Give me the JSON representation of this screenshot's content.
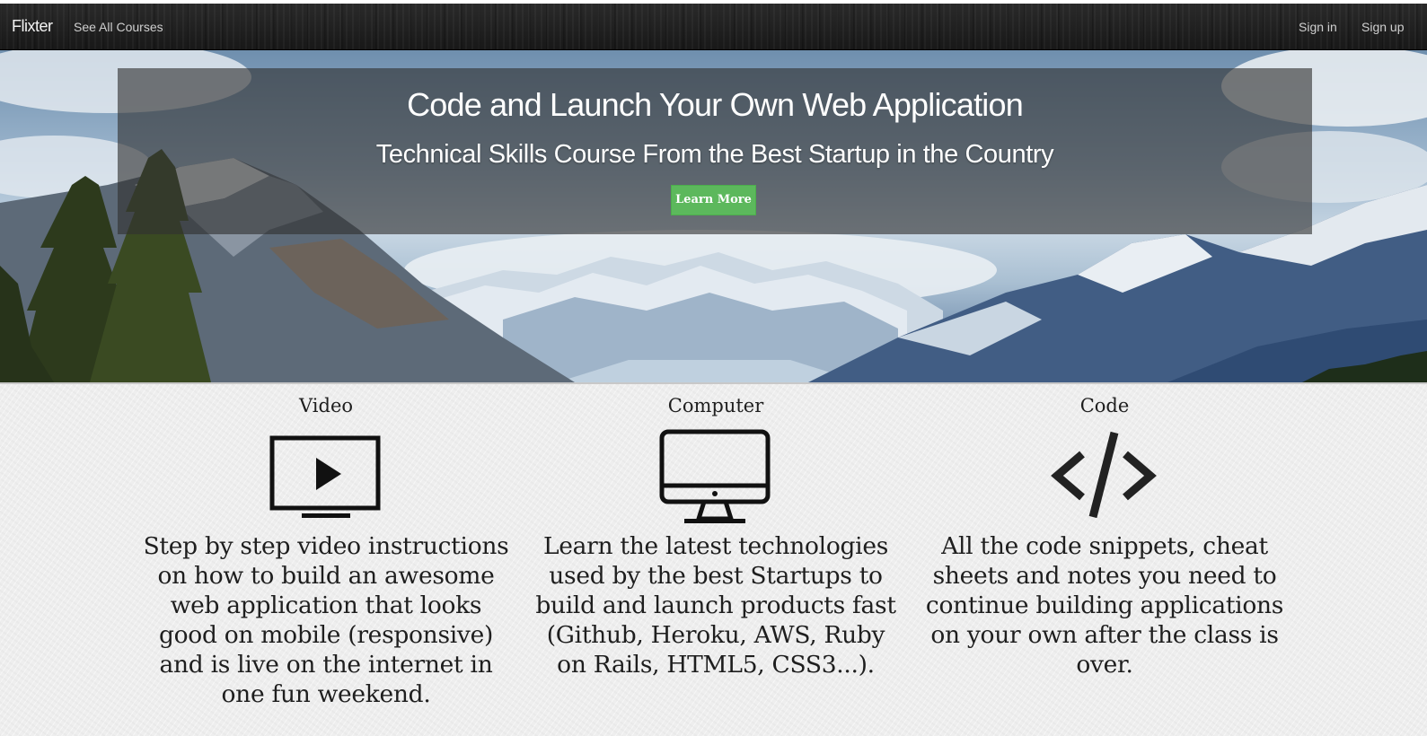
{
  "navbar": {
    "brand": "Flixter",
    "links": {
      "courses": "See All Courses",
      "signin": "Sign in",
      "signup": "Sign up"
    }
  },
  "hero": {
    "title": "Code and Launch Your Own Web Application",
    "subtitle": "Technical Skills Course From the Best Startup in the Country",
    "button_label": "Learn More",
    "button_color": "#5cb85c"
  },
  "features": [
    {
      "heading": "Video",
      "icon": "video-play-icon",
      "text": "Step by step video instructions on how to build an awesome web application that looks good on mobile (responsive) and is live on the internet in one fun weekend."
    },
    {
      "heading": "Computer",
      "icon": "desktop-computer-icon",
      "text": "Learn the latest technologies used by the best Startups to build and launch products fast (Github, Heroku, AWS, Ruby on Rails, HTML5, CSS3...)."
    },
    {
      "heading": "Code",
      "icon": "code-brackets-icon",
      "text": "All the code snippets, cheat sheets and notes you need to continue building applications on your own after the class is over."
    }
  ]
}
